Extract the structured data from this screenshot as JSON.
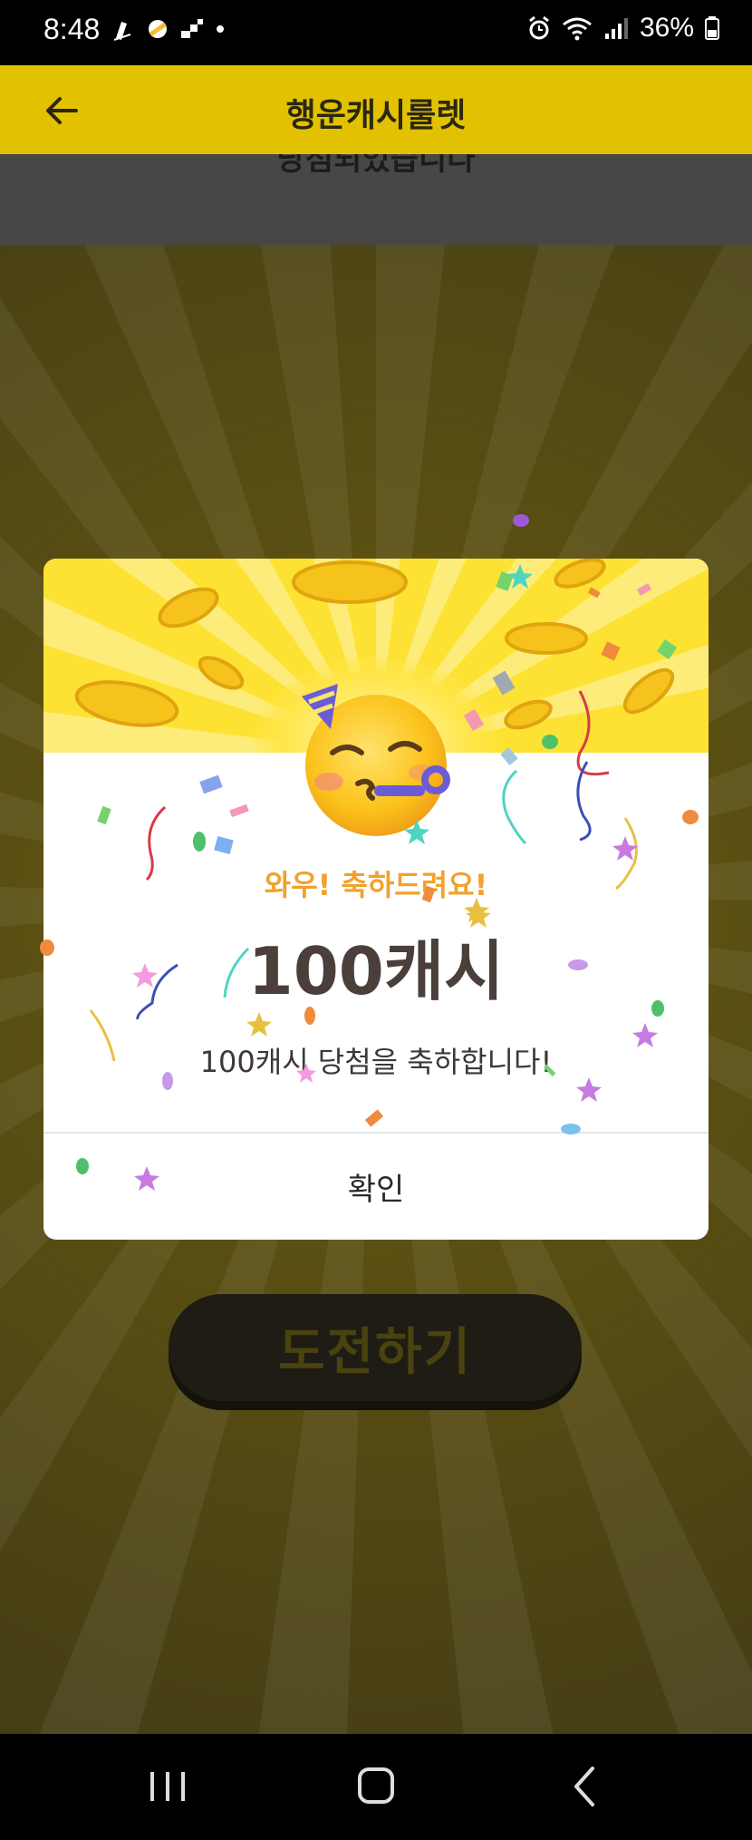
{
  "status": {
    "time": "8:48",
    "battery": "36%"
  },
  "header": {
    "title": "행운캐시룰렛"
  },
  "behind": {
    "cut_text": "당첨되었습니다",
    "challenge_label": "도전하기"
  },
  "modal": {
    "congrats": "와우! 축하드려요!",
    "amount": "100캐시",
    "description": "100캐시 당첨을 축하합니다!",
    "confirm_label": "확인"
  },
  "colors": {
    "accent_yellow": "#fde233",
    "app_bar": "#e2c200",
    "congrats_orange": "#f0a22a",
    "amount_text": "#4a3f3a"
  }
}
